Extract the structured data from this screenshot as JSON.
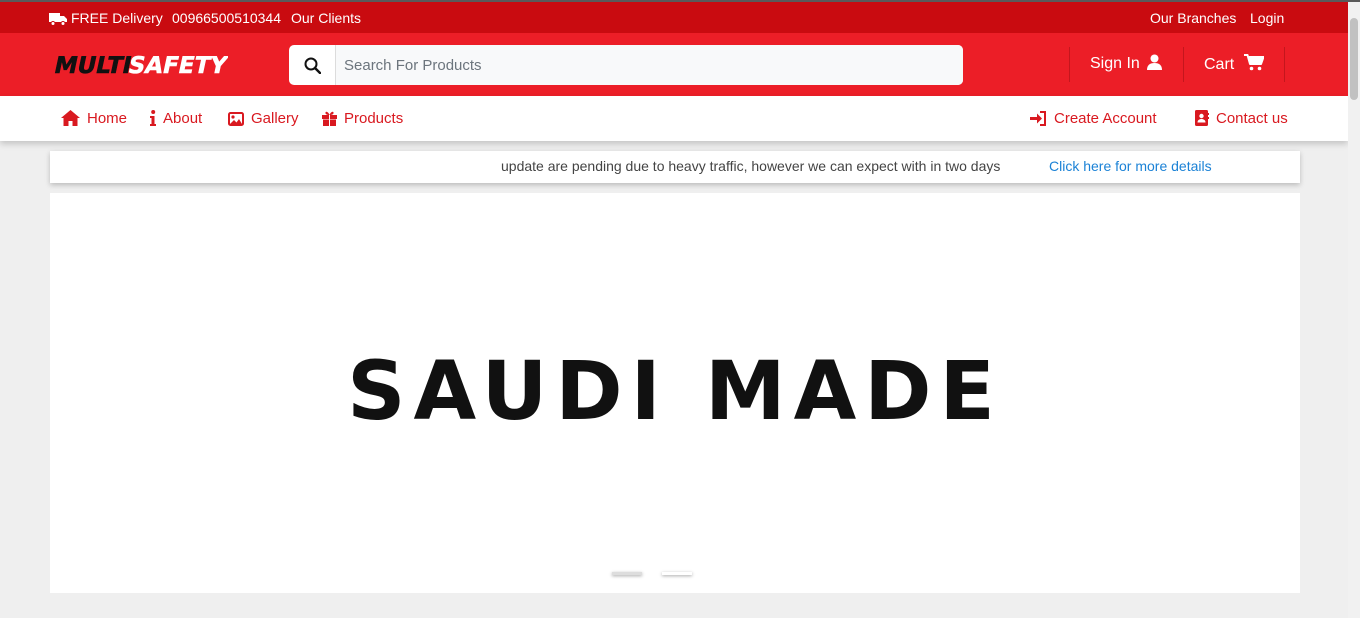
{
  "topbar": {
    "delivery": "FREE Delivery",
    "phone": "00966500510344",
    "clients": "Our Clients",
    "branches": "Our Branches",
    "login": "Login"
  },
  "header": {
    "logo_left": "MULTI",
    "logo_right": "SAFETY",
    "search_placeholder": "Search For Products",
    "sign_in": "Sign In",
    "cart": "Cart"
  },
  "nav": {
    "home": "Home",
    "about": "About",
    "gallery": "Gallery",
    "products": "Products",
    "create_account": "Create Account",
    "contact": "Contact us"
  },
  "notice": {
    "message": "update are pending due to heavy traffic, however we can expect with in two days",
    "link": "Click here for more details"
  },
  "carousel": {
    "slide_text": "SAUDI MADE",
    "slide_count": 2,
    "active_slide": 2
  },
  "colors": {
    "topbar": "#c90b10",
    "header": "#ec1e27",
    "nav_text": "#d91920",
    "link": "#1b82d6"
  }
}
